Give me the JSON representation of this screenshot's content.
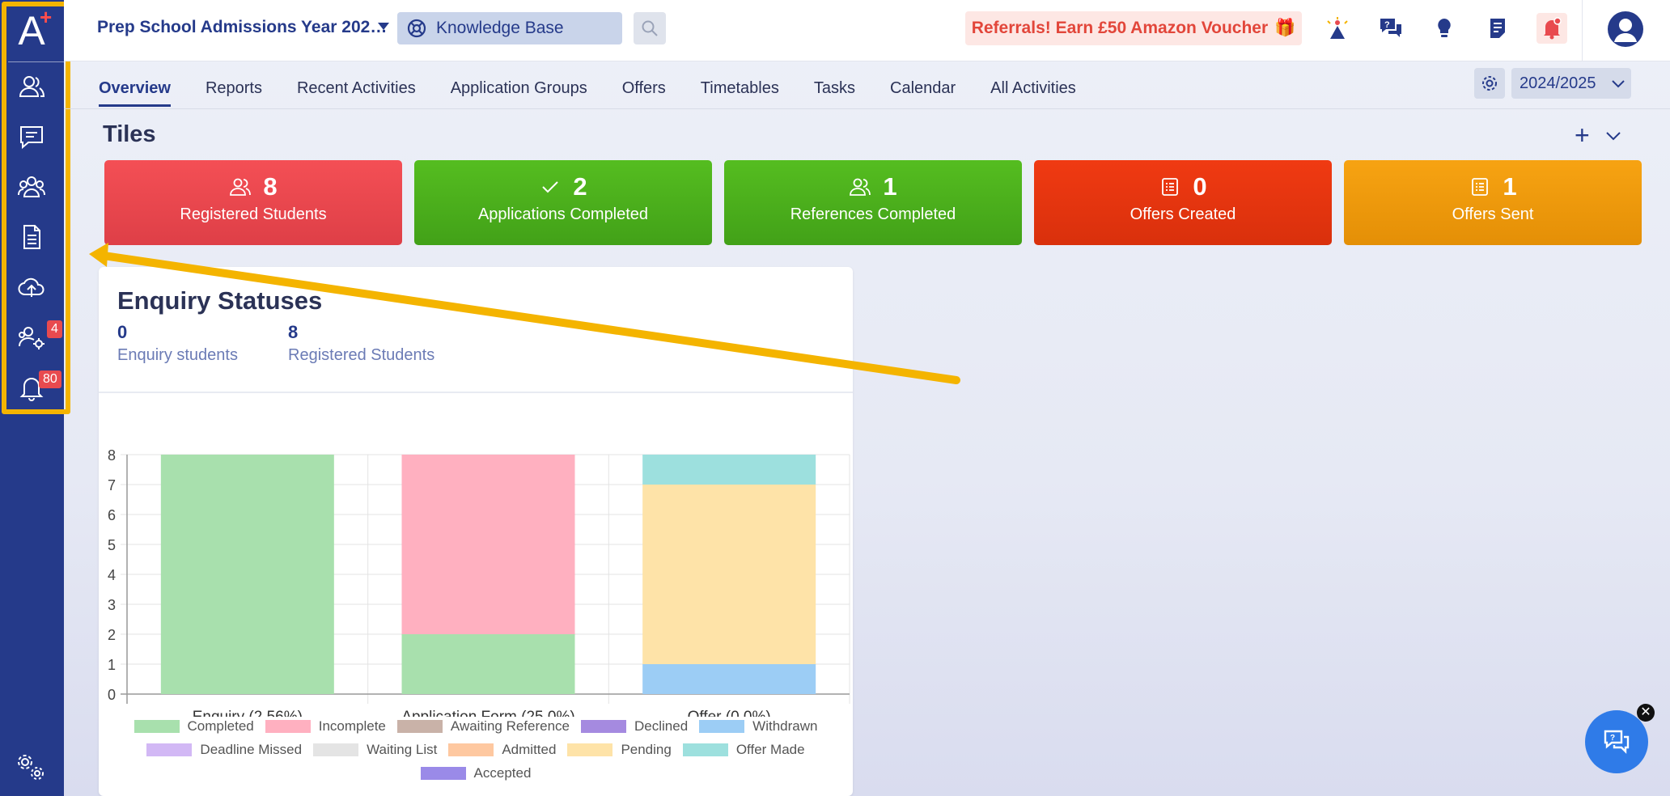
{
  "logo": {
    "letter": "A",
    "plus": "+"
  },
  "sidebar": {
    "items": [
      {
        "icon": "users-icon"
      },
      {
        "icon": "message-icon"
      },
      {
        "icon": "group-icon"
      },
      {
        "icon": "document-icon"
      },
      {
        "icon": "cloud-upload-icon"
      },
      {
        "icon": "user-settings-icon",
        "badge": "4"
      },
      {
        "icon": "bell-icon",
        "badge": "80"
      }
    ],
    "settings_icon": "settings-icon"
  },
  "header": {
    "title": "Prep School Admissions Year 202…",
    "knowledge_base": "Knowledge Base",
    "referral": "Referrals! Earn £50 Amazon Voucher",
    "referral_emoji": "🎁"
  },
  "tabs": [
    {
      "label": "Overview",
      "active": true
    },
    {
      "label": "Reports"
    },
    {
      "label": "Recent Activities"
    },
    {
      "label": "Application Groups"
    },
    {
      "label": "Offers"
    },
    {
      "label": "Timetables"
    },
    {
      "label": "Tasks"
    },
    {
      "label": "Calendar"
    },
    {
      "label": "All Activities"
    }
  ],
  "year": "2024/2025",
  "tiles_section": {
    "title": "Tiles",
    "add": "+",
    "tiles": [
      {
        "count": "8",
        "label": "Registered Students",
        "color": "#e8474f",
        "icon": "users-icon"
      },
      {
        "count": "2",
        "label": "Applications Completed",
        "color": "#4caf1e",
        "icon": "check-icon"
      },
      {
        "count": "1",
        "label": "References Completed",
        "color": "#4caf1e",
        "icon": "users-icon"
      },
      {
        "count": "0",
        "label": "Offers Created",
        "color": "#e83510",
        "icon": "list-icon"
      },
      {
        "count": "1",
        "label": "Offers Sent",
        "color": "#f29a0b",
        "icon": "list-icon"
      }
    ]
  },
  "enquiry": {
    "title": "Enquiry Statuses",
    "stats": [
      {
        "value": "0",
        "label": "Enquiry students"
      },
      {
        "value": "8",
        "label": "Registered Students"
      }
    ]
  },
  "chart_data": {
    "type": "bar",
    "stacked": true,
    "categories": [
      "Enquiry (2.56%)",
      "Application Form (25.0%)",
      "Offer (0.0%)"
    ],
    "ylim": [
      0,
      8
    ],
    "yticks": [
      "0",
      "1",
      "2",
      "3",
      "4",
      "5",
      "6",
      "7",
      "8"
    ],
    "grid": true,
    "legend_position": "bottom",
    "series": [
      {
        "name": "Completed",
        "color": "#a8e0ad",
        "values": [
          8,
          2,
          0
        ]
      },
      {
        "name": "Incomplete",
        "color": "#ffb0c0",
        "values": [
          0,
          6,
          0
        ]
      },
      {
        "name": "Awaiting Reference",
        "color": "#c9b2a8",
        "values": [
          0,
          0,
          0
        ]
      },
      {
        "name": "Declined",
        "color": "#a58ae0",
        "values": [
          0,
          0,
          0
        ]
      },
      {
        "name": "Withdrawn",
        "color": "#9ccdf5",
        "values": [
          0,
          0,
          1
        ]
      },
      {
        "name": "Deadline Missed",
        "color": "#d2b8f5",
        "values": [
          0,
          0,
          0
        ]
      },
      {
        "name": "Waiting List",
        "color": "#e4e4e4",
        "values": [
          0,
          0,
          0
        ]
      },
      {
        "name": "Admitted",
        "color": "#fec8a0",
        "values": [
          0,
          0,
          0
        ]
      },
      {
        "name": "Pending",
        "color": "#fee3a8",
        "values": [
          0,
          0,
          6
        ]
      },
      {
        "name": "Offer Made",
        "color": "#9de0de",
        "values": [
          0,
          0,
          1
        ]
      },
      {
        "name": "Accepted",
        "color": "#9a8ae8",
        "values": [
          0,
          0,
          0
        ]
      }
    ]
  },
  "colors": {
    "sidebar": "#253a8a",
    "accent": "#253a8a",
    "annotation": "#f4b400",
    "badge": "#e84a4f"
  }
}
